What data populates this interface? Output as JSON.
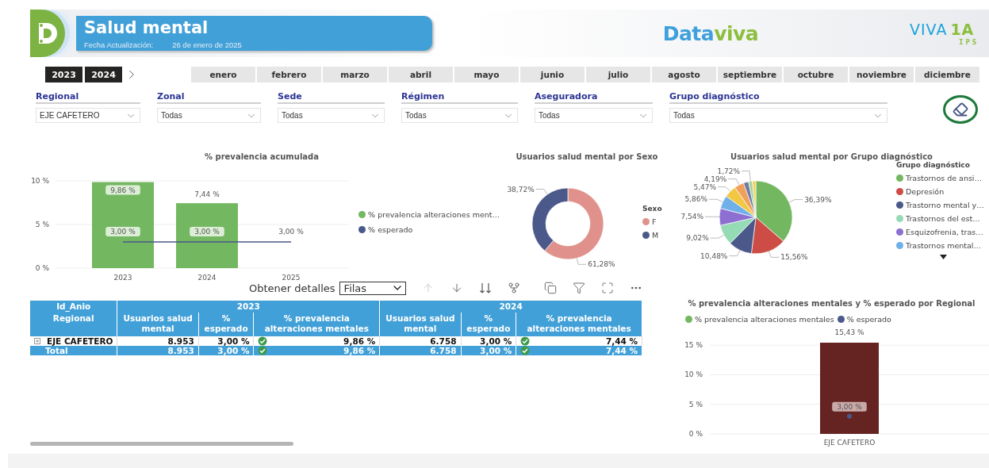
{
  "header": {
    "title": "Salud mental",
    "update_label": "Fecha Actualización:",
    "update_date": "26 de enero de 2025",
    "brand": [
      "Data",
      "viva"
    ],
    "partner": {
      "name": "VIVA",
      "number": "1A",
      "sub": "IPS"
    }
  },
  "years": [
    {
      "label": "2023",
      "selected": true
    },
    {
      "label": "2024",
      "selected": true
    }
  ],
  "months": [
    {
      "label": "enero",
      "selected": false
    },
    {
      "label": "febrero",
      "selected": false
    },
    {
      "label": "marzo",
      "selected": false
    },
    {
      "label": "abril",
      "selected": false
    },
    {
      "label": "mayo",
      "selected": false
    },
    {
      "label": "junio",
      "selected": false
    },
    {
      "label": "julio",
      "selected": false
    },
    {
      "label": "agosto",
      "selected": false
    },
    {
      "label": "septiembre",
      "selected": false
    },
    {
      "label": "octubre",
      "selected": false
    },
    {
      "label": "noviembre",
      "selected": false
    },
    {
      "label": "diciembre",
      "selected": false
    }
  ],
  "filters": [
    {
      "label": "Regional",
      "value": "EJE CAFETERO"
    },
    {
      "label": "Zonal",
      "value": "Todas"
    },
    {
      "label": "Sede",
      "value": "Todas"
    },
    {
      "label": "Régimen",
      "value": "Todas"
    },
    {
      "label": "Aseguradora",
      "value": "Todas"
    },
    {
      "label": "Grupo diagnóstico",
      "value": "Todas"
    }
  ],
  "prevalence_chart": {
    "title": "% prevalencia acumulada",
    "chart_data": {
      "type": "bar",
      "categories": [
        "2023",
        "2024",
        "2025"
      ],
      "series": [
        {
          "name": "% prevalencia alteraciones ment…",
          "type": "bar",
          "color": "#73b761",
          "values": [
            9.86,
            7.44,
            null
          ],
          "value_labels": [
            "9,86 %",
            "7,44 %",
            null
          ]
        },
        {
          "name": "% esperado",
          "type": "line",
          "color": "#4a588a",
          "values": [
            3,
            3,
            3
          ],
          "value_labels": [
            "3,00 %",
            "3,00 %",
            "3,00 %"
          ]
        }
      ],
      "ylim": [
        0,
        10
      ],
      "yticks": [
        {
          "value": 0,
          "label": "0 %"
        },
        {
          "value": 5,
          "label": "5 %"
        },
        {
          "value": 10,
          "label": "10 %"
        }
      ],
      "grid": true
    }
  },
  "sex_chart": {
    "title": "Usuarios salud mental por Sexo",
    "legend_title": "Sexo",
    "chart_data": {
      "type": "donut",
      "categories": [
        "F",
        "M"
      ],
      "values": [
        61.28,
        38.72
      ],
      "colors": [
        "#e0918b",
        "#4a588a"
      ],
      "value_labels": [
        "61,28%",
        "38,72%"
      ]
    }
  },
  "group_chart": {
    "title": "Usuarios salud mental por Grupo diagnóstico",
    "legend_title": "Grupo diagnóstico",
    "legend": [
      {
        "label": "Trastornos de ansi…",
        "color": "#73b761"
      },
      {
        "label": "Depresión",
        "color": "#cd4c46"
      },
      {
        "label": "Trastorno mental y…",
        "color": "#4a588a"
      },
      {
        "label": "Trastornos del est…",
        "color": "#95dbb6"
      },
      {
        "label": "Esquizofrenia, tras…",
        "color": "#8d6fd1"
      },
      {
        "label": "Trastornos mental…",
        "color": "#6fb0e8"
      }
    ],
    "chart_data": {
      "type": "pie",
      "values": [
        36.39,
        15.56,
        10.48,
        9.02,
        7.54,
        5.86,
        5.47,
        4.19,
        2.27,
        1.72,
        1.5
      ],
      "colors": [
        "#73b761",
        "#cd4c46",
        "#4a588a",
        "#95dbb6",
        "#8d6fd1",
        "#6fb0e8",
        "#f2c744",
        "#f0a05a",
        "#6f7ba3",
        "#a9d39e",
        "#f2d35a"
      ],
      "value_labels": [
        "36,39%",
        "15,56%",
        "10,48%",
        "9,02%",
        "7,54%",
        "5,86%",
        "5,47%",
        "4,19%",
        null,
        "1,72%",
        null
      ]
    }
  },
  "toolbar": {
    "label": "Obtener detalles",
    "mode": "Filas",
    "drill_up_disabled": true
  },
  "table": {
    "groups": [
      "Id_Anio",
      "2023",
      "2024"
    ],
    "columns": [
      "Regional",
      "Usuarios salud mental",
      "% esperado",
      "% prevalencia alteraciones mentales",
      "Usuarios salud mental",
      "% esperado",
      "% prevalencia alteraciones mentales"
    ],
    "rows": [
      {
        "kind": "row",
        "cells": [
          {
            "text": "EJE CAFETERO"
          },
          {
            "text": "8.953"
          },
          {
            "text": "3,00 %"
          },
          {
            "text": "9,86 %",
            "check": true
          },
          {
            "text": "6.758"
          },
          {
            "text": "3,00 %"
          },
          {
            "text": "7,44 %",
            "check": true
          }
        ]
      },
      {
        "kind": "total",
        "cells": [
          {
            "text": "Total"
          },
          {
            "text": "8.953"
          },
          {
            "text": "3,00 %"
          },
          {
            "text": "9,86 %",
            "check": true
          },
          {
            "text": "6.758"
          },
          {
            "text": "3,00 %"
          },
          {
            "text": "7,44 %",
            "check": true
          }
        ]
      }
    ]
  },
  "regional_chart": {
    "title": "% prevalencia alteraciones mentales y % esperado por Regional",
    "legend": [
      {
        "color": "#73b761"
      },
      {
        "color": "#4a588a"
      }
    ],
    "chart_data": {
      "type": "bar",
      "categories": [
        "EJE CAFETERO"
      ],
      "series": [
        {
          "name": "% prevalencia alteraciones mentales",
          "type": "bar",
          "color": "#652322",
          "values": [
            15.43
          ],
          "value_labels": [
            "15,43 %"
          ]
        },
        {
          "name": "% esperado",
          "type": "scatter",
          "color": "#4a588a",
          "values": [
            3
          ],
          "value_labels": [
            "3,00 %"
          ]
        }
      ],
      "ylim": [
        0,
        15.43
      ],
      "yticks": [
        {
          "value": 0,
          "label": "0 %"
        },
        {
          "value": 5,
          "label": "5 %"
        },
        {
          "value": 10,
          "label": "10 %"
        },
        {
          "value": 15,
          "label": "15 %"
        }
      ],
      "grid": true
    }
  }
}
